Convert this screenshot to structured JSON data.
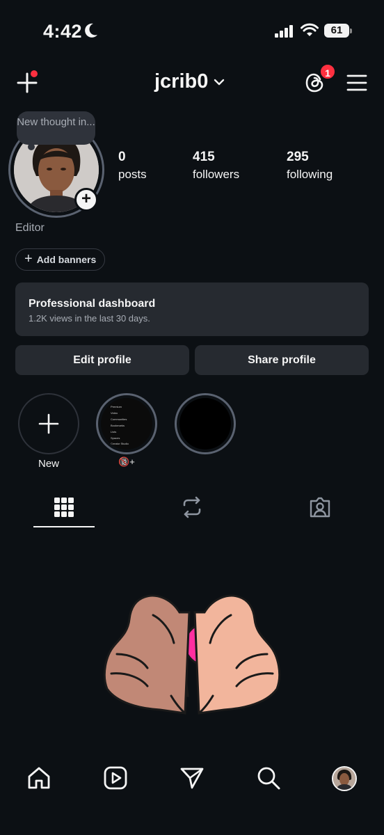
{
  "status_bar": {
    "time": "4:42",
    "battery": "61"
  },
  "header": {
    "username": "jcrib0",
    "threads_badge": "1"
  },
  "profile": {
    "note": "New thought in...",
    "category": "Editor",
    "stats": [
      {
        "value": "0",
        "label": "posts"
      },
      {
        "value": "415",
        "label": "followers"
      },
      {
        "value": "295",
        "label": "following"
      }
    ],
    "add_banners_label": "Add banners"
  },
  "dashboard": {
    "title": "Professional dashboard",
    "subtitle": "1.2K views in the last 30 days."
  },
  "buttons": {
    "edit": "Edit profile",
    "share": "Share profile"
  },
  "highlights": [
    {
      "label": "New"
    },
    {
      "label": "🔞+",
      "mini_menu": [
        "Premium",
        "Video",
        "Communities",
        "Bookmarks",
        "Lists",
        "Spaces",
        "Creator Studio"
      ]
    },
    {
      "label": ""
    }
  ],
  "tabs": [
    "grid-tab",
    "reposts-tab",
    "tagged-tab"
  ],
  "nav": [
    "home",
    "reels",
    "messages",
    "search",
    "profile"
  ],
  "colors": {
    "background": "#0c1014",
    "card": "#262a30",
    "notification": "#ff3040",
    "ring": "#5a6270"
  }
}
